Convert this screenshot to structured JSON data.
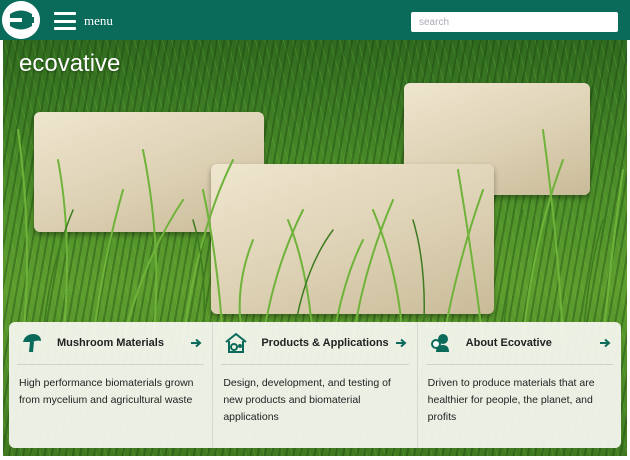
{
  "header": {
    "menu_label": "menu",
    "search_placeholder": "search",
    "search_value": ""
  },
  "hero": {
    "brand": "ecovative"
  },
  "cards": [
    {
      "title": "Mushroom Materials",
      "description": "High performance biomaterials grown from mycelium and agricultural waste",
      "icon": "mushroom-icon"
    },
    {
      "title": "Products & Applications",
      "description": "Design, development, and testing of new products and biomaterial applications",
      "icon": "house-gear-icon"
    },
    {
      "title": "About Ecovative",
      "description": "Driven to produce materials that are healthier for people, the planet, and profits",
      "icon": "person-gear-icon"
    }
  ],
  "colors": {
    "header_bg": "#0b6b5a",
    "accent": "#0b6b5a"
  }
}
